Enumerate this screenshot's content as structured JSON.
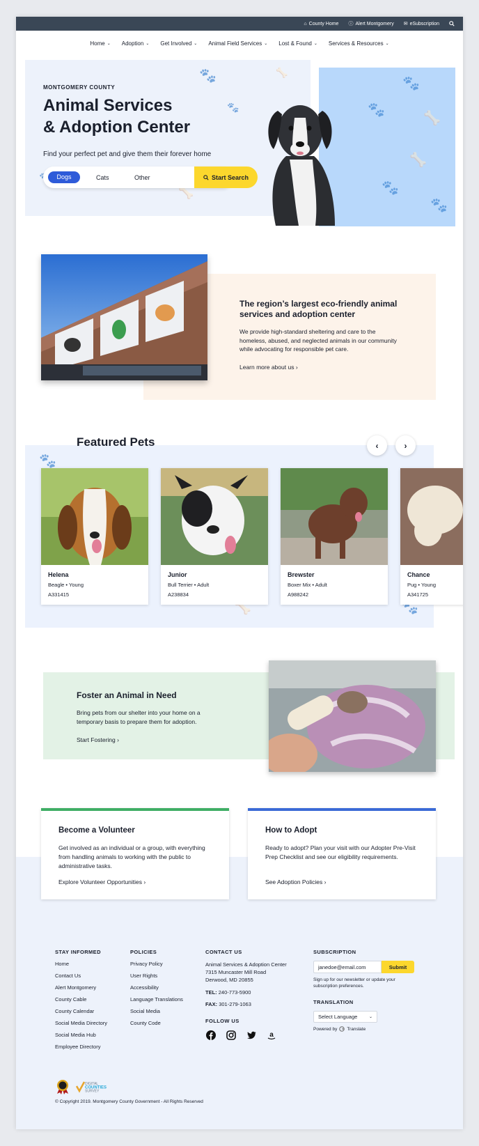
{
  "colors": {
    "util_bar": "#3a4756",
    "accent_blue": "#2e5bd9",
    "accent_yellow": "#fcd72d",
    "hero_bg": "#edf2fb",
    "hero_right_bg": "#b8d8fb",
    "about_bg": "#fdf3ea",
    "foster_bg": "#e3f2e6",
    "volunteer_bar": "#3fae65",
    "adopt_bar": "#3b6ad6"
  },
  "utility": {
    "county_home": "County Home",
    "alert": "Alert Montgomery",
    "esub": "eSubscription",
    "icons": [
      "home-icon",
      "alert-icon",
      "mail-icon",
      "search-icon"
    ]
  },
  "nav": {
    "items": [
      "Home",
      "Adoption",
      "Get Involved",
      "Animal Field Services",
      "Lost & Found",
      "Services & Resources"
    ]
  },
  "hero": {
    "eyebrow": "MONTGOMERY COUNTY",
    "title_line1": "Animal Services",
    "title_line2": "& Adoption Center",
    "subtitle": "Find your perfect pet and give them their forever home",
    "options": [
      "Dogs",
      "Cats",
      "Other"
    ],
    "selected": "Dogs",
    "search_label": "Start Search"
  },
  "about": {
    "title": "The region’s largest eco-friendly animal services and adoption center",
    "text": "We provide high-standard sheltering and care to the homeless, abused, and neglected animals in our community while advocating for responsible pet care.",
    "link": "Learn more about us"
  },
  "featured": {
    "title": "Featured Pets",
    "pets": [
      {
        "name": "Helena",
        "breed": "Beagle • Young",
        "id": "A331415"
      },
      {
        "name": "Junior",
        "breed": "Bull Terrier • Adult",
        "id": "A238834"
      },
      {
        "name": "Brewster",
        "breed": "Boxer Mix • Adult",
        "id": "A988242"
      },
      {
        "name": "Chance",
        "breed": "Pug • Young",
        "id": "A341725"
      }
    ]
  },
  "foster": {
    "title": "Foster an Animal in Need",
    "text": "Bring pets from our shelter into your home on a temporary basis to prepare them for adoption.",
    "link": "Start Fostering"
  },
  "volunteer": {
    "title": "Become a Volunteer",
    "text": "Get involved as an individual or a group, with everything from handling animals to working with the public to administrative tasks.",
    "link": "Explore Volunteer Opportunities"
  },
  "adopt": {
    "title": "How to Adopt",
    "text": "Ready to adopt? Plan your visit with our Adopter Pre-Visit Prep Checklist and see our eligibility requirements.",
    "link": "See Adoption Policies"
  },
  "footer": {
    "stay_informed": {
      "heading": "STAY INFORMED",
      "links": [
        "Home",
        "Contact Us",
        "Alert Montgomery",
        "County Cable",
        "County Calendar",
        "Social Media Directory",
        "Social Media Hub",
        "Employee Directory"
      ]
    },
    "policies": {
      "heading": "POLICIES",
      "links": [
        "Privacy Policy",
        "User Rights",
        "Accessibility",
        "Language Translations",
        "Social Media",
        "County Code"
      ]
    },
    "contact": {
      "heading": "CONTACT US",
      "org": "Animal Services & Adoption Center",
      "street": "7315 Muncaster Mill Road",
      "city": "Derwood, MD 20855",
      "tel_label": "TEL:",
      "tel": "240-773-5900",
      "fax_label": "FAX:",
      "fax": "301-279-1063",
      "follow": "FOLLOW US",
      "social_icons": [
        "facebook-icon",
        "instagram-icon",
        "twitter-icon",
        "amazon-icon"
      ]
    },
    "subscription": {
      "heading": "SUBSCRIPTION",
      "email_value": "janedoe@email.com",
      "submit": "Submit",
      "note": "Sign up for our newsletter or update your subscription preferences."
    },
    "translation": {
      "heading": "TRANSLATION",
      "select_value": "Select Language",
      "powered_by": "Powered by",
      "translate": "Translate"
    },
    "copyright": "© Copyright 2019. Montgomery County Government - All Rights Reserved"
  }
}
